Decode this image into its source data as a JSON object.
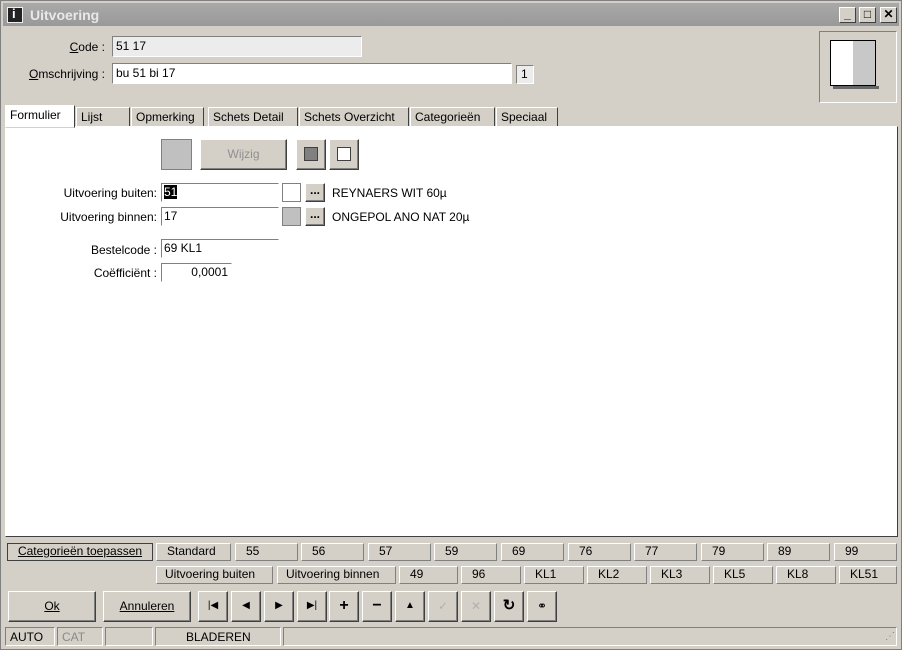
{
  "window": {
    "title": "Uitvoering"
  },
  "header": {
    "code_label": "Code :",
    "code_value": "51 17",
    "desc_label": "Omschrijving :",
    "desc_value": "bu 51 bi 17",
    "lang_index": "1"
  },
  "tabs": [
    {
      "label": "Formulier"
    },
    {
      "label": "Lijst"
    },
    {
      "label": "Opmerking"
    },
    {
      "label": "Schets Detail"
    },
    {
      "label": "Schets Overzicht"
    },
    {
      "label": "Categorieën"
    },
    {
      "label": "Speciaal"
    }
  ],
  "form": {
    "wijzig_label": "Wijzig",
    "buiten_label": "Uitvoering buiten:",
    "buiten_value": "51",
    "buiten_desc": "REYNAERS WIT 60µ",
    "binnen_label": "Uitvoering binnen:",
    "binnen_value": "17",
    "binnen_desc": "ONGEPOL ANO NAT 20µ",
    "bestelcode_label": "Bestelcode :",
    "bestelcode_value": "69 KL1",
    "coeff_label": "Coëfficiënt :",
    "coeff_value": "0,0001",
    "browse_label": "..."
  },
  "categories": {
    "apply_label": "Categorieën toepassen",
    "row1": [
      "Standard",
      "55",
      "56",
      "57",
      "59",
      "69",
      "76",
      "77",
      "79",
      "89",
      "99"
    ],
    "row2": [
      "Uitvoering buiten",
      "Uitvoering binnen",
      "49",
      "96",
      "KL1",
      "KL2",
      "KL3",
      "KL5",
      "KL8",
      "KL51"
    ]
  },
  "buttons": {
    "ok": "Ok",
    "cancel": "Annuleren"
  },
  "status": {
    "mode": "AUTO",
    "cat": "CAT",
    "state": "BLADEREN"
  },
  "colors": {
    "titlebar": "#9e9e9e",
    "swatch_grey": "#c0c0c0"
  }
}
